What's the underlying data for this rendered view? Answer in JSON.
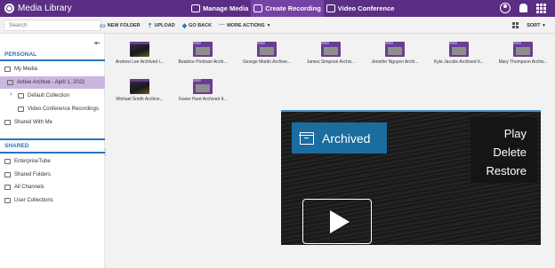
{
  "app": {
    "title": "Media Library"
  },
  "topnav": [
    {
      "label": "Manage Media"
    },
    {
      "label": "Create Recording"
    },
    {
      "label": "Video Conference"
    }
  ],
  "search": {
    "placeholder": "Search"
  },
  "toolbar": {
    "new_folder": "NEW FOLDER",
    "upload": "UPLOAD",
    "go_back": "GO BACK",
    "more_actions": "MORE ACTIONS",
    "sort": "SORT"
  },
  "sidebar": {
    "personal_title": "PERSONAL",
    "personal": [
      {
        "label": "My Media"
      },
      {
        "label": "Active Archive - April 1, 2022"
      },
      {
        "label": "Default Collection"
      },
      {
        "label": "Video Conference Recordings"
      },
      {
        "label": "Shared With Me"
      }
    ],
    "shared_title": "SHARED",
    "shared": [
      {
        "label": "EnterpriseTube"
      },
      {
        "label": "Shared Folders"
      },
      {
        "label": "All Channels"
      },
      {
        "label": "User Collections"
      }
    ]
  },
  "items": [
    {
      "label": "Andrew Lee Archived I...",
      "kind": "video"
    },
    {
      "label": "Beatrice Portinari Archi...",
      "kind": "folder"
    },
    {
      "label": "George Martin Archive...",
      "kind": "folder"
    },
    {
      "label": "James Simpson Archiv...",
      "kind": "folder"
    },
    {
      "label": "Jennifer Nguyen Archi...",
      "kind": "folder"
    },
    {
      "label": "Kyle Jacobs Archived It...",
      "kind": "folder"
    },
    {
      "label": "Mary Thompson Archiv...",
      "kind": "folder"
    },
    {
      "label": "Michael Smith Archive...",
      "kind": "video"
    },
    {
      "label": "Xavier Hunt Archived It...",
      "kind": "folder"
    }
  ],
  "preview": {
    "badge": "Archived",
    "actions": [
      "Play",
      "Delete",
      "Restore"
    ]
  },
  "colors": {
    "brand": "#5b2e84",
    "accent": "#2a73c0",
    "archived_badge": "#1a6d9e"
  }
}
